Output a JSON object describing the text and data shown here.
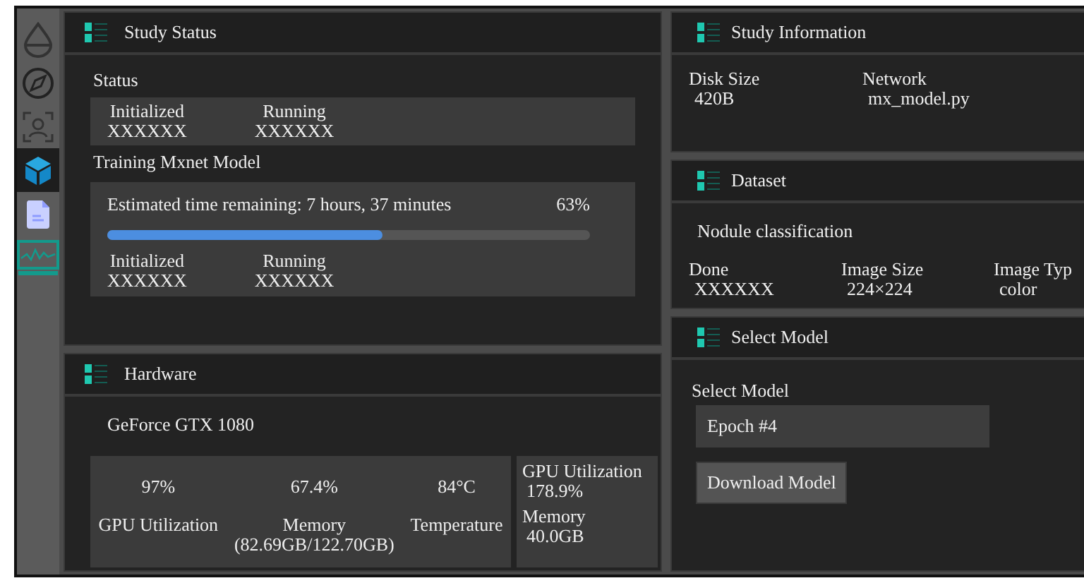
{
  "sidebar": {
    "items": [
      {
        "kind": "drop",
        "selected": false
      },
      {
        "kind": "compass",
        "selected": false
      },
      {
        "kind": "person",
        "selected": false
      },
      {
        "kind": "cube",
        "selected": true
      },
      {
        "kind": "document",
        "selected": false
      },
      {
        "kind": "monitor",
        "selected": false
      }
    ]
  },
  "study_status": {
    "title": "Study Status",
    "status_label": "Status",
    "status": [
      {
        "label": "Initialized",
        "value": "XXXXXX"
      },
      {
        "label": "Running",
        "value": "XXXXXX"
      }
    ],
    "training": {
      "title": "Training Mxnet Model",
      "estimate": "Estimated time remaining: 7 hours, 37 minutes",
      "percent": "63%",
      "level": 0.57,
      "status": [
        {
          "label": "Initialized",
          "value": "XXXXXX"
        },
        {
          "label": "Running",
          "value": "XXXXXX"
        }
      ]
    }
  },
  "hardware": {
    "title": "Hardware",
    "gpu_name": "GeForce GTX 1080",
    "metrics": [
      {
        "value": "97%",
        "label": "GPU Utilization"
      },
      {
        "value": "67.4%",
        "label": "Memory\n(82.69GB/122.70GB)"
      },
      {
        "value": "84°C",
        "label": "Temperature"
      }
    ],
    "side": [
      {
        "label": "GPU Utilization",
        "value": "178.9%"
      },
      {
        "label": "Memory",
        "value": "40.0GB"
      }
    ]
  },
  "study_information": {
    "title": "Study Information",
    "fields": [
      {
        "label": "Disk Size",
        "value": "420B"
      },
      {
        "label": "Network",
        "value": "mx_model.py"
      }
    ]
  },
  "dataset": {
    "title": "Dataset",
    "name": "Nodule classification",
    "fields": [
      {
        "label": "Done",
        "value": "XXXXXX"
      },
      {
        "label": "Image Size",
        "value": "224×224"
      },
      {
        "label": "Image Typ",
        "value": "color"
      }
    ]
  },
  "select_model": {
    "title": "Select Model",
    "field_label": "Select Model",
    "value": "Epoch #4",
    "button": "Download Model"
  }
}
